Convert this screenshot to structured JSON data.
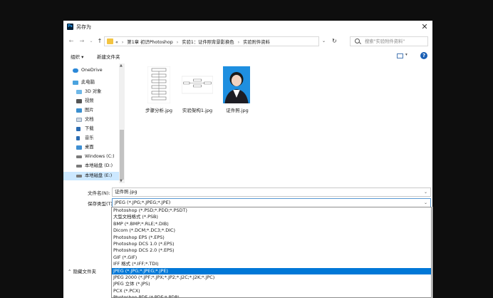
{
  "window": {
    "title": "另存为",
    "app_icon": "Ps"
  },
  "address": {
    "crumbs": [
      "«",
      "第1章 初识Photoshop",
      "实验1：证件照背景影换色",
      "实验附件资料"
    ],
    "search_placeholder": "搜索\"实验附件资料\""
  },
  "toolbar": {
    "organize": "组织 ▾",
    "new_folder": "新建文件夹"
  },
  "nav": {
    "items": [
      {
        "label": "OneDrive",
        "icon": "cloud-icon"
      },
      {
        "label": "此电脑",
        "icon": "computer-icon"
      },
      {
        "label": "3D 对象",
        "icon": "cube-icon"
      },
      {
        "label": "视频",
        "icon": "video-icon"
      },
      {
        "label": "图片",
        "icon": "picture-icon"
      },
      {
        "label": "文档",
        "icon": "document-icon"
      },
      {
        "label": "下载",
        "icon": "download-icon"
      },
      {
        "label": "音乐",
        "icon": "music-icon"
      },
      {
        "label": "桌面",
        "icon": "desktop-icon"
      },
      {
        "label": "Windows (C:)",
        "icon": "drive-icon"
      },
      {
        "label": "本地磁盘 (D:)",
        "icon": "drive-icon"
      },
      {
        "label": "本地磁盘 (E:)",
        "icon": "drive-icon"
      }
    ]
  },
  "files": [
    {
      "name": "步骤分析.jpg"
    },
    {
      "name": "实验架构1.jpg"
    },
    {
      "name": "证件照.jpg"
    }
  ],
  "form": {
    "filename_label": "文件名(N):",
    "filename_value": "证件照.jpg",
    "filetype_label": "保存类型(T):",
    "filetype_value": "JPEG (*.JPG;*.JPEG;*.JPE)",
    "hide_folders": "隐藏文件夹"
  },
  "filetype_options": [
    "Photoshop (*.PSD;*.PDD;*.PSDT)",
    "大型文档格式 (*.PSB)",
    "BMP (*.BMP;*.RLE;*.DIB)",
    "Dicom (*.DCM;*.DC3;*.DIC)",
    "Photoshop EPS (*.EPS)",
    "Photoshop DCS 1.0 (*.EPS)",
    "Photoshop DCS 2.0 (*.EPS)",
    "GIF (*.GIF)",
    "IFF 格式 (*.IFF;*.TDI)",
    "JPEG (*.JPG;*.JPEG;*.JPE)",
    "JPEG 2000 (*.JPF;*.JPX;*.JP2;*.J2C;*.J2K;*.JPC)",
    "JPEG 立体 (*.JPS)",
    "PCX (*.PCX)",
    "Photoshop PDF (*.PDF;*.PDP)"
  ],
  "selected_filetype_index": 9,
  "colors": {
    "accent": "#0078d7",
    "selection": "#cce8ff",
    "folder": "#f3c441"
  }
}
